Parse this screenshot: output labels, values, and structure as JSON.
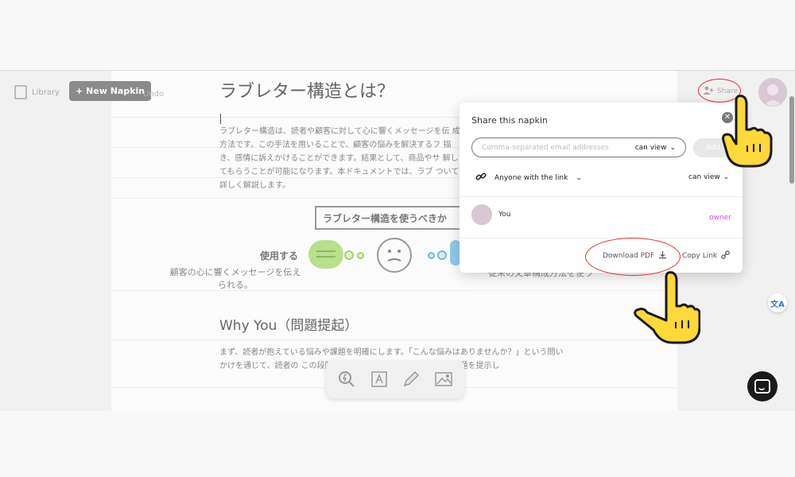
{
  "left": {
    "library_label": "Library",
    "new_button_label": "+ New Napkin",
    "undo_label": "Undo"
  },
  "document": {
    "title": "ラブレター構造とは？",
    "intro": "ラブレター構造は、読者や顧客に対して心に響くメッセージを伝 成方法です。この手法を用いることで、顧客の悩みを解決するフ 描き、感情に訴えかけることができます。結果として、商品やサ 解してもらうことが可能になります。本ドキュメントでは、ラブ ついて詳しく解説します。",
    "callout": "ラブレター構造を使うべきか",
    "use_label": "使用する",
    "caption_left": "顧客の心に響くメッセージを伝えられる。",
    "caption_right": "従来の文章構成方法を使う",
    "section_heading": "Why You（問題提起）",
    "section_text": "まず、読者が抱えている悩みや課題を明確にします。「こんな悩みはありませんか？」という問いかけを通じて、読者の この段階では、読者が共感できる具体的な問題を提示し"
  },
  "header": {
    "share_label": "Share"
  },
  "share_modal": {
    "title": "Share this napkin",
    "email_placeholder": "Comma-separated email addresses",
    "email_permission": "can view",
    "add_label": "Add",
    "link_scope": "Anyone with the link",
    "link_permission": "can view",
    "user_name": "You",
    "user_role": "owner",
    "download_label": "Download PDF",
    "copy_link_label": "Copy Link"
  },
  "floating": {
    "translate_glyph": "文A"
  },
  "colors": {
    "owner_accent": "#c64cd8",
    "annotation_red": "#dd3333",
    "hand_yellow": "#ffd83a"
  }
}
